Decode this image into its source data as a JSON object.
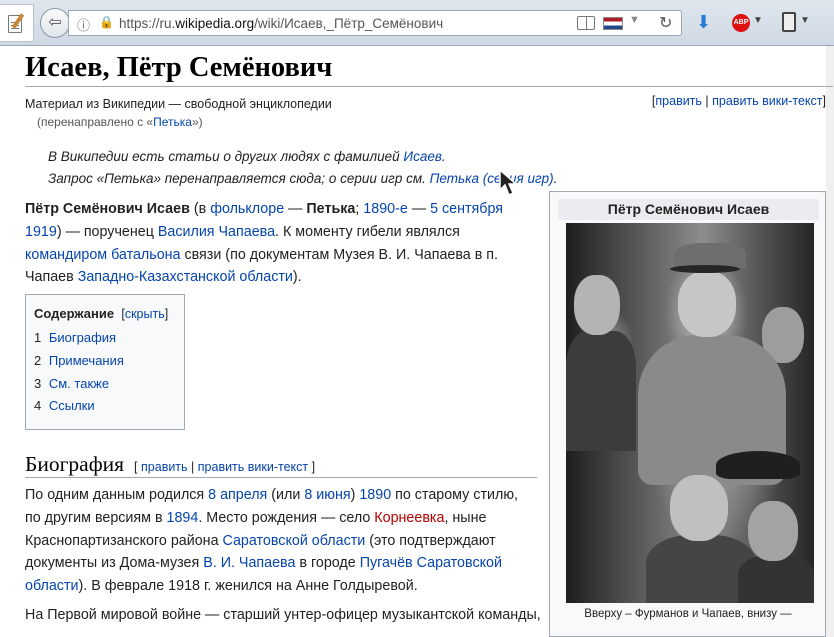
{
  "browser": {
    "url_prefix": "https://ru.",
    "url_domain": "wikipedia.org",
    "url_path": "/wiki/Исаев,_Пётр_Семёнович",
    "back_glyph": "⇦",
    "info_glyph": "ⓘ",
    "lock_glyph": "🔒",
    "reload_glyph": "↻",
    "dropdown_glyph": "▼",
    "download_glyph": "⬇",
    "abp_label": "ABP"
  },
  "article": {
    "title": "Исаев, Пётр Семёнович",
    "sitesub": "Материал из Википедии — свободной энциклопедии",
    "redirected_prefix": "(перенаправлено с «",
    "redirected_link": "Петька",
    "redirected_suffix": "»)",
    "edit_top": {
      "open": "[",
      "edit": "править",
      "sep": " | ",
      "edit_source": "править вики-текст",
      "close": "]"
    },
    "hatnote1": {
      "text": "В Википедии есть статьи о других людях с фамилией ",
      "link": "Исаев",
      "end": "."
    },
    "hatnote2": {
      "text": "Запрос «Петька» перенаправляется сюда; о серии игр см. ",
      "link": "Петька (серия игр)",
      "end": "."
    },
    "intro": {
      "l1_name": "Пётр Семёнович Исаев",
      "l1_a": " (в ",
      "l1_link1": "фольклоре",
      "l1_b": " — ",
      "l1_bold": "Петька",
      "l1_c": "; ",
      "l1_link2": "1890-е",
      "l1_d": " — ",
      "l1_link3": "5 сентября",
      "l2_link1": "1919",
      "l2_a": ") — порученец ",
      "l2_link2": "Василия Чапаева",
      "l2_b": ". К моменту гибели являлся",
      "l3_link1": "командиром батальона",
      "l3_a": " связи (по документам Музея В. И. Чапаева в п.",
      "l4_a": "Чапаев ",
      "l4_link1": "Западно-Казахстанской области",
      "l4_b": ")."
    },
    "toc": {
      "title": "Содержание",
      "hide_open": "[",
      "hide": "скрыть",
      "hide_close": "]",
      "items": [
        {
          "num": "1",
          "label": "Биография"
        },
        {
          "num": "2",
          "label": "Примечания"
        },
        {
          "num": "3",
          "label": "См. также"
        },
        {
          "num": "4",
          "label": "Ссылки"
        }
      ]
    },
    "section_biography": {
      "title": "Биография",
      "edit_open": "[",
      "edit": "править",
      "sep": " | ",
      "edit_source": "править вики-текст",
      "edit_close": " ]"
    },
    "bio": {
      "l1_a": "По одним данным родился ",
      "l1_link1": "8 апреля",
      "l1_b": " (или ",
      "l1_link2": "8 июня",
      "l1_c": ") ",
      "l1_link3": "1890",
      "l1_d": " по старому стилю,",
      "l2_a": "по другим версиям в ",
      "l2_link1": "1894",
      "l2_b": ". Место рождения — село ",
      "l2_redlink": "Корнеевка",
      "l2_c": ", ныне",
      "l3_a": "Краснопартизанского района ",
      "l3_link1": "Саратовской области",
      "l3_b": " (это подтверждают",
      "l4_a": "документы из Дома-музея ",
      "l4_link1": "В. И. Чапаева",
      "l4_b": " в городе ",
      "l4_link2": "Пугачёв",
      "l4_c": " ",
      "l4_link3": "Саратовской",
      "l5_link1": "области",
      "l5_a": "). В феврале 1918 г. женился на Анне Голдыревой.",
      "l6_a": "На Первой мировой войне — старший унтер-офицер музыкантской команды,"
    },
    "infobox": {
      "title": "Пётр Семёнович Исаев",
      "caption": "Вверху – Фурманов и Чапаев, внизу —"
    }
  }
}
